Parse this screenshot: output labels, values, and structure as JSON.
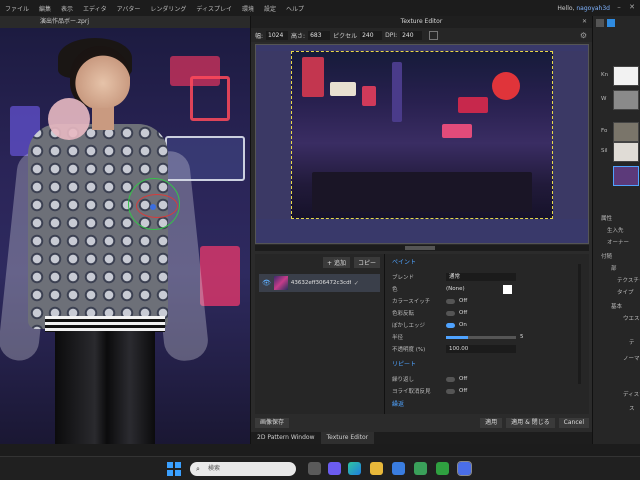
{
  "menu": {
    "items": [
      "ファイル",
      "編集",
      "表示",
      "エディタ",
      "アバター",
      "レンダリング",
      "ディスプレイ",
      "環境",
      "設定",
      "ヘルプ"
    ],
    "greeting_prefix": "Hello, ",
    "username": "nagoyah3d"
  },
  "viewport": {
    "tab_label": "演出作品ボー.zprj"
  },
  "editor": {
    "title": "Texture Editor",
    "toolbar": {
      "width_label": "幅:",
      "width_value": "1024",
      "height_label": "高さ:",
      "height_value": "683",
      "dpi_label": "ピクセル",
      "dpi_value": "240",
      "dpi2_label": "DPI:",
      "dpi2_value": "240"
    },
    "layers": {
      "add_label": "+ 追加",
      "copy_label": "コピー",
      "item_name": "43632eff306472c3cdf",
      "item_option": "✓"
    },
    "props": {
      "section_paint": "ペイント",
      "blend_label": "ブレンド",
      "blend_value": "通常",
      "color_label": "色",
      "color_value": "(None)",
      "color_swatch": "#ffffff",
      "color_switch_label": "カラースイッチ",
      "color_switch_value": "Off",
      "invert_label": "色彩反転",
      "invert_value": "Off",
      "soft_edge_label": "ぼかしエッジ",
      "soft_edge_value": "On",
      "radius_label": "半径",
      "radius_value": "5",
      "opacity_label": "不透明度 (%)",
      "opacity_value": "100.00",
      "section_repeat": "リピート",
      "repeat_label": "繰り返し",
      "repeat_value": "Off",
      "seam_label": "ヨライ取消反見",
      "seam_value": "Off",
      "more": "繰返"
    },
    "buttons": {
      "save_label": "画像保存",
      "apply_label": "適用",
      "apply_close_label": "適用 & 閉じる",
      "cancel_label": "Cancel"
    },
    "tabs": [
      "2D Pattern Window",
      "Texture Editor"
    ]
  },
  "right_panel": {
    "labels": [
      "Kn",
      "W",
      "Fo",
      "Sil"
    ],
    "list": [
      "属性",
      "生入先",
      "オーナー",
      "付随",
      "部",
      "テクスチャ",
      "タイプ",
      "基本",
      "ウエスト",
      "テ",
      "ノーマル",
      "ディスプレ",
      "ス"
    ]
  },
  "taskbar": {
    "search_placeholder": "検索"
  }
}
